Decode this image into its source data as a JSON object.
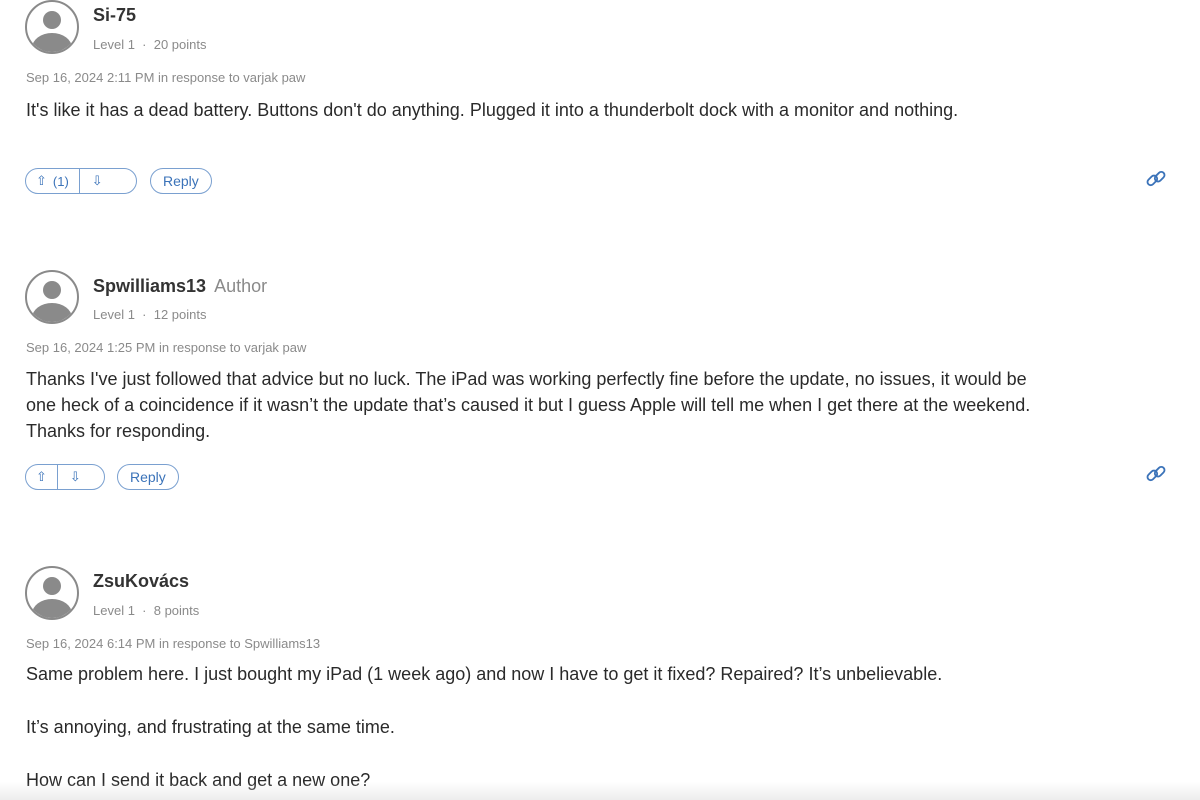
{
  "colors": {
    "accent": "#3b73b9",
    "muted": "#8a8a8a"
  },
  "posts": [
    {
      "name": "Si-75",
      "level": "Level 1",
      "points": "20 points",
      "date": "Sep 16, 2024 2:11 PM in response to varjak paw",
      "body": [
        "It's like it has a dead battery. Buttons don't do anything. Plugged it into a thunderbolt dock with a monitor and nothing."
      ],
      "upvote_count": "(1)",
      "reply_label": "Reply"
    },
    {
      "name": "Spwilliams13",
      "badge": "Author",
      "level": "Level 1",
      "points": "12 points",
      "date": "Sep 16, 2024 1:25 PM in response to varjak paw",
      "body": [
        "Thanks I've just followed that advice but no luck. The iPad was working perfectly fine before the update, no issues, it would be",
        "one heck of a coincidence if it wasn’t the update that’s caused it but I guess Apple will tell me when I get there at the weekend.",
        "Thanks for responding."
      ],
      "reply_label": "Reply"
    },
    {
      "name": "ZsuKovács",
      "level": "Level 1",
      "points": "8 points",
      "date": "Sep 16, 2024 6:14 PM in response to Spwilliams13",
      "body": [
        "Same problem here. I just bought my iPad (1 week ago) and now I have to get it fixed? Repaired? It’s unbelievable.",
        "It’s annoying, and frustrating at the same time.",
        "How can I send it back and get a new one?"
      ]
    }
  ],
  "separator": "·",
  "icons": {
    "upvote": "arrow-up-icon",
    "downvote": "arrow-down-icon",
    "link": "link-icon",
    "avatar": "user-avatar-icon"
  }
}
